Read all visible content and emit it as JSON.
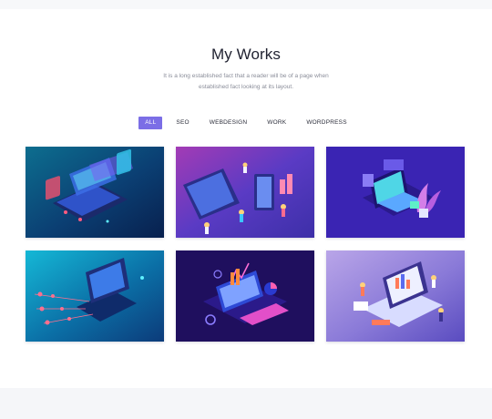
{
  "section": {
    "title": "My Works",
    "subtitle_line1": "It is a long established fact that a reader will be of a page when",
    "subtitle_line2": "established fact looking at its layout."
  },
  "filters": [
    {
      "label": "ALL",
      "active": true
    },
    {
      "label": "SEO",
      "active": false
    },
    {
      "label": "WEBDESIGN",
      "active": false
    },
    {
      "label": "WORK",
      "active": false
    },
    {
      "label": "WORDPRESS",
      "active": false
    }
  ],
  "colors": {
    "accent": "#7b6ee6",
    "title": "#1f2130",
    "muted_text": "#8a8d99"
  },
  "portfolio_items": [
    {
      "illustration": "isometric-laptop-screens-teal"
    },
    {
      "illustration": "isometric-web-design-team-purple"
    },
    {
      "illustration": "isometric-online-shopping-laptop"
    },
    {
      "illustration": "isometric-laptop-network-cyan"
    },
    {
      "illustration": "isometric-data-analytics-dark"
    },
    {
      "illustration": "isometric-team-dashboard-lavender"
    }
  ]
}
